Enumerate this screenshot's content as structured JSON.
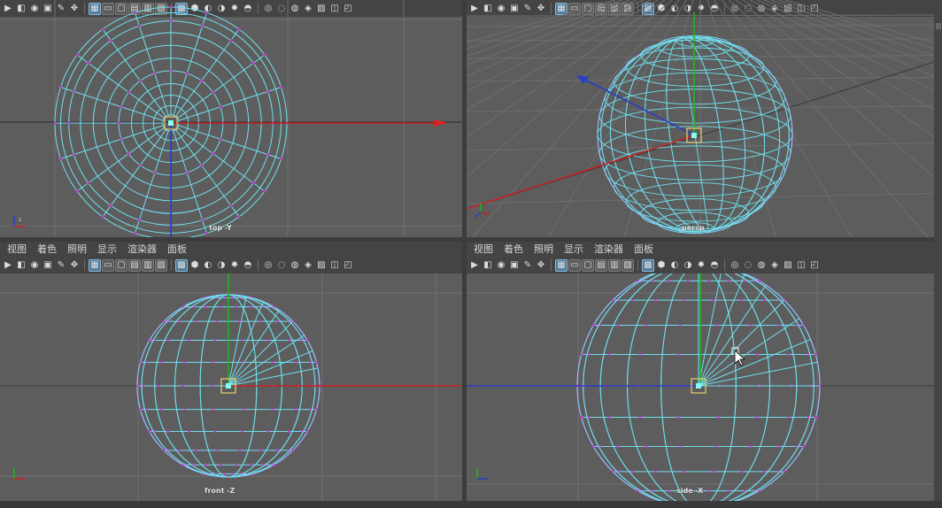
{
  "menus": {
    "items": [
      "视图",
      "着色",
      "照明",
      "显示",
      "渲染器",
      "面板"
    ]
  },
  "viewports": {
    "top": {
      "label": "top -Y"
    },
    "persp": {
      "label": "persp"
    },
    "front": {
      "label": "front -Z"
    },
    "side": {
      "label": "side -X"
    }
  },
  "icons": {
    "toolbar": [
      "select-camera-icon",
      "camera-attributes-icon",
      "bookmark-icon",
      "image-plane-icon",
      "grease-pencil-icon",
      "2d-pan-icon",
      "grid-icon",
      "film-gate-icon",
      "resolution-gate-icon",
      "gate-mask-icon",
      "field-chart-icon",
      "safe-action-icon",
      "wireframe-icon",
      "smooth-shade-icon",
      "default-material-icon",
      "textures-icon",
      "lights-icon",
      "shadows-icon",
      "isolate-select-icon",
      "xray-icon",
      "xray-joints-icon",
      "backface-icon",
      "antialias-icon",
      "ambient-occlusion-icon",
      "motion-blur-icon"
    ]
  },
  "colors": {
    "wire": "#6fe0ee",
    "vertex": "#c03fcf",
    "axis_x": "#c62222",
    "axis_y": "#22b422",
    "axis_z": "#2a3cc8",
    "grid": "#737373",
    "background": "#5d5d5d"
  }
}
